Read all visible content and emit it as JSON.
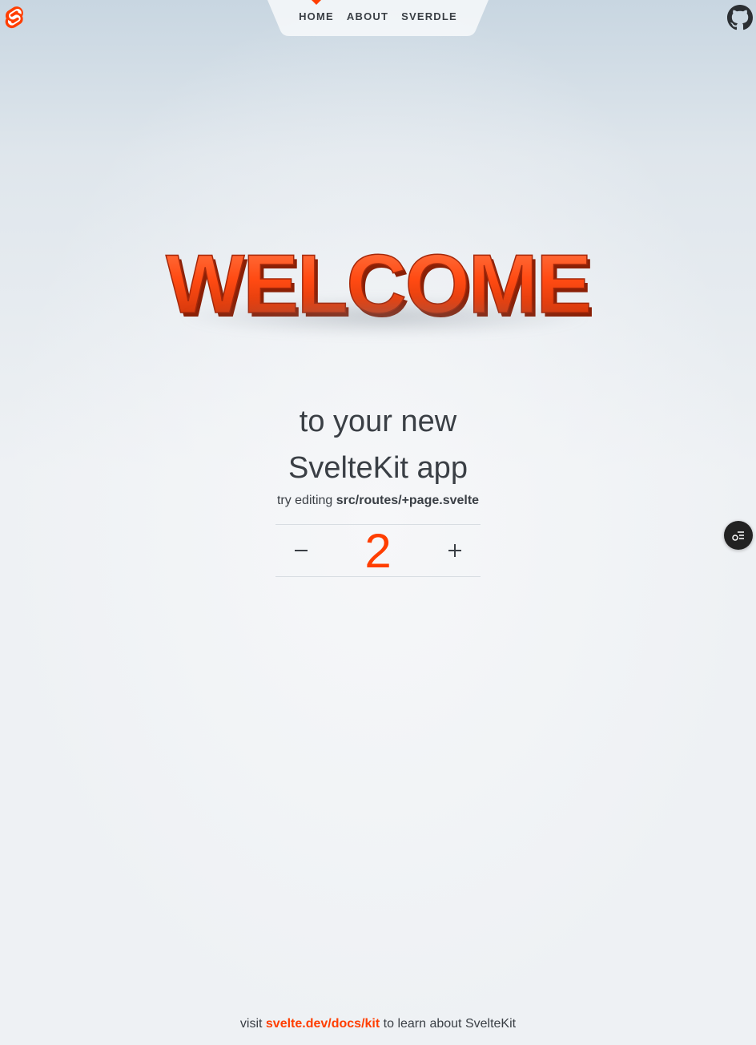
{
  "header": {
    "logo_icon": "svelte-logo-icon",
    "nav": [
      {
        "label": "HOME",
        "active": true
      },
      {
        "label": "ABOUT",
        "active": false
      },
      {
        "label": "SVERDLE",
        "active": false
      }
    ],
    "github_icon": "github-icon"
  },
  "hero": {
    "welcome_text": "WELCOME",
    "line1": "to your new",
    "line2": "SvelteKit app",
    "hint_prefix": "try editing ",
    "hint_path": "src/routes/+page.svelte"
  },
  "counter": {
    "value": "2",
    "decrement_icon": "minus-icon",
    "increment_icon": "plus-icon"
  },
  "devtools": {
    "icon": "devtools-toggle-icon"
  },
  "footer": {
    "prefix": "visit ",
    "link": "svelte.dev/docs/kit",
    "suffix": " to learn about SvelteKit"
  },
  "colors": {
    "accent": "#ff3e00",
    "text": "#3a3f45"
  }
}
